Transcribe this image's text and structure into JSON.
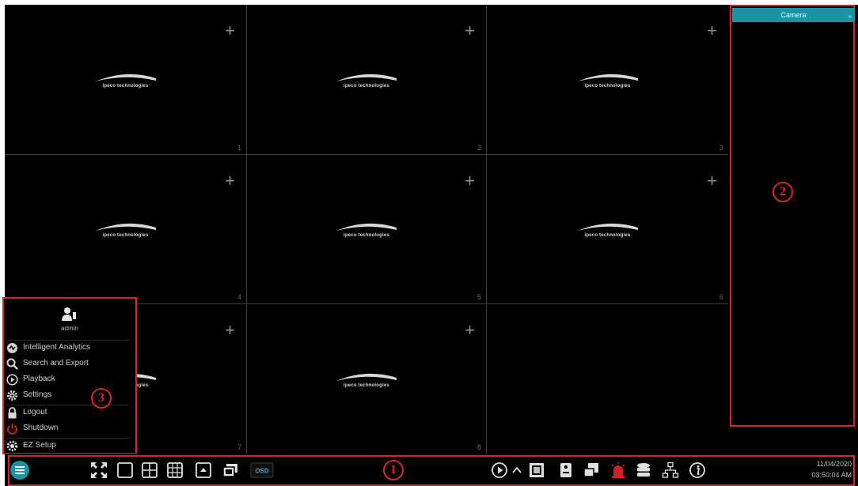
{
  "cameras": [
    {
      "number": "1",
      "logo": "ipeco technologies"
    },
    {
      "number": "2",
      "logo": "ipeco technologies"
    },
    {
      "number": "3",
      "logo": "ipeco technologies"
    },
    {
      "number": "4",
      "logo": "ipeco technologies"
    },
    {
      "number": "5",
      "logo": "ipeco technologies"
    },
    {
      "number": "6",
      "logo": "ipeco technologies"
    },
    {
      "number": "7",
      "logo": "ipeco technologies"
    },
    {
      "number": "8",
      "logo": "ipeco technologies"
    }
  ],
  "add_camera_icon": "plus-icon",
  "right_panel": {
    "title": "Camera",
    "pin_icon": "pin-icon",
    "callout": "2"
  },
  "menu": {
    "user": "admin",
    "callout": "3",
    "items": [
      {
        "label": "Intelligent Analytics",
        "icon": "analytics-icon"
      },
      {
        "label": "Search and Export",
        "icon": "search-icon"
      },
      {
        "label": "Playback",
        "icon": "playback-icon"
      },
      {
        "label": "Settings",
        "icon": "gear-icon"
      },
      {
        "label": "Logout",
        "icon": "lock-icon"
      },
      {
        "label": "Shutdown",
        "icon": "power-icon"
      },
      {
        "label": "EZ Setup",
        "icon": "ez-setup-icon"
      }
    ]
  },
  "toolbar": {
    "callout": "1",
    "osd_label": "OSD",
    "left_buttons": [
      "start-menu-icon",
      "fullscreen-icon",
      "layout-1-icon",
      "layout-4-icon",
      "layout-9-icon",
      "pip-icon",
      "multi-screen-icon",
      "osd-icon"
    ],
    "right_buttons": [
      "sequence-play-icon",
      "expand-up-icon",
      "snapshot-icon",
      "disk-icon",
      "record-icon",
      "alarm-icon",
      "storage-icon",
      "network-icon",
      "info-icon"
    ],
    "date": "11/04/2020",
    "time": "03:50:04 AM"
  },
  "colors": {
    "highlight": "#d9232d",
    "accent": "#1c93a4",
    "alarm": "#d01f26",
    "background": "#000000"
  }
}
